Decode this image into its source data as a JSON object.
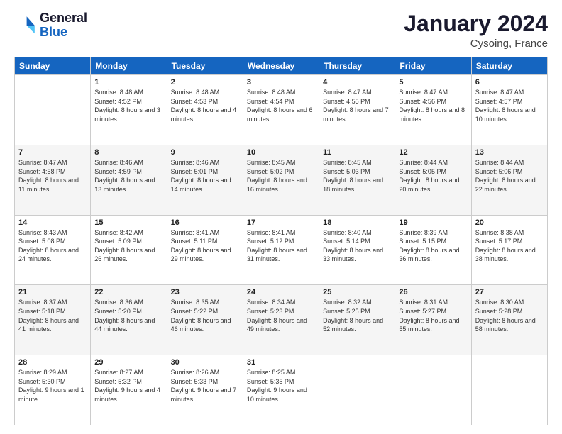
{
  "logo": {
    "line1": "General",
    "line2": "Blue"
  },
  "title": "January 2024",
  "subtitle": "Cysoing, France",
  "days_header": [
    "Sunday",
    "Monday",
    "Tuesday",
    "Wednesday",
    "Thursday",
    "Friday",
    "Saturday"
  ],
  "weeks": [
    [
      {
        "num": "",
        "sunrise": "",
        "sunset": "",
        "daylight": ""
      },
      {
        "num": "1",
        "sunrise": "Sunrise: 8:48 AM",
        "sunset": "Sunset: 4:52 PM",
        "daylight": "Daylight: 8 hours and 3 minutes."
      },
      {
        "num": "2",
        "sunrise": "Sunrise: 8:48 AM",
        "sunset": "Sunset: 4:53 PM",
        "daylight": "Daylight: 8 hours and 4 minutes."
      },
      {
        "num": "3",
        "sunrise": "Sunrise: 8:48 AM",
        "sunset": "Sunset: 4:54 PM",
        "daylight": "Daylight: 8 hours and 6 minutes."
      },
      {
        "num": "4",
        "sunrise": "Sunrise: 8:47 AM",
        "sunset": "Sunset: 4:55 PM",
        "daylight": "Daylight: 8 hours and 7 minutes."
      },
      {
        "num": "5",
        "sunrise": "Sunrise: 8:47 AM",
        "sunset": "Sunset: 4:56 PM",
        "daylight": "Daylight: 8 hours and 8 minutes."
      },
      {
        "num": "6",
        "sunrise": "Sunrise: 8:47 AM",
        "sunset": "Sunset: 4:57 PM",
        "daylight": "Daylight: 8 hours and 10 minutes."
      }
    ],
    [
      {
        "num": "7",
        "sunrise": "Sunrise: 8:47 AM",
        "sunset": "Sunset: 4:58 PM",
        "daylight": "Daylight: 8 hours and 11 minutes."
      },
      {
        "num": "8",
        "sunrise": "Sunrise: 8:46 AM",
        "sunset": "Sunset: 4:59 PM",
        "daylight": "Daylight: 8 hours and 13 minutes."
      },
      {
        "num": "9",
        "sunrise": "Sunrise: 8:46 AM",
        "sunset": "Sunset: 5:01 PM",
        "daylight": "Daylight: 8 hours and 14 minutes."
      },
      {
        "num": "10",
        "sunrise": "Sunrise: 8:45 AM",
        "sunset": "Sunset: 5:02 PM",
        "daylight": "Daylight: 8 hours and 16 minutes."
      },
      {
        "num": "11",
        "sunrise": "Sunrise: 8:45 AM",
        "sunset": "Sunset: 5:03 PM",
        "daylight": "Daylight: 8 hours and 18 minutes."
      },
      {
        "num": "12",
        "sunrise": "Sunrise: 8:44 AM",
        "sunset": "Sunset: 5:05 PM",
        "daylight": "Daylight: 8 hours and 20 minutes."
      },
      {
        "num": "13",
        "sunrise": "Sunrise: 8:44 AM",
        "sunset": "Sunset: 5:06 PM",
        "daylight": "Daylight: 8 hours and 22 minutes."
      }
    ],
    [
      {
        "num": "14",
        "sunrise": "Sunrise: 8:43 AM",
        "sunset": "Sunset: 5:08 PM",
        "daylight": "Daylight: 8 hours and 24 minutes."
      },
      {
        "num": "15",
        "sunrise": "Sunrise: 8:42 AM",
        "sunset": "Sunset: 5:09 PM",
        "daylight": "Daylight: 8 hours and 26 minutes."
      },
      {
        "num": "16",
        "sunrise": "Sunrise: 8:41 AM",
        "sunset": "Sunset: 5:11 PM",
        "daylight": "Daylight: 8 hours and 29 minutes."
      },
      {
        "num": "17",
        "sunrise": "Sunrise: 8:41 AM",
        "sunset": "Sunset: 5:12 PM",
        "daylight": "Daylight: 8 hours and 31 minutes."
      },
      {
        "num": "18",
        "sunrise": "Sunrise: 8:40 AM",
        "sunset": "Sunset: 5:14 PM",
        "daylight": "Daylight: 8 hours and 33 minutes."
      },
      {
        "num": "19",
        "sunrise": "Sunrise: 8:39 AM",
        "sunset": "Sunset: 5:15 PM",
        "daylight": "Daylight: 8 hours and 36 minutes."
      },
      {
        "num": "20",
        "sunrise": "Sunrise: 8:38 AM",
        "sunset": "Sunset: 5:17 PM",
        "daylight": "Daylight: 8 hours and 38 minutes."
      }
    ],
    [
      {
        "num": "21",
        "sunrise": "Sunrise: 8:37 AM",
        "sunset": "Sunset: 5:18 PM",
        "daylight": "Daylight: 8 hours and 41 minutes."
      },
      {
        "num": "22",
        "sunrise": "Sunrise: 8:36 AM",
        "sunset": "Sunset: 5:20 PM",
        "daylight": "Daylight: 8 hours and 44 minutes."
      },
      {
        "num": "23",
        "sunrise": "Sunrise: 8:35 AM",
        "sunset": "Sunset: 5:22 PM",
        "daylight": "Daylight: 8 hours and 46 minutes."
      },
      {
        "num": "24",
        "sunrise": "Sunrise: 8:34 AM",
        "sunset": "Sunset: 5:23 PM",
        "daylight": "Daylight: 8 hours and 49 minutes."
      },
      {
        "num": "25",
        "sunrise": "Sunrise: 8:32 AM",
        "sunset": "Sunset: 5:25 PM",
        "daylight": "Daylight: 8 hours and 52 minutes."
      },
      {
        "num": "26",
        "sunrise": "Sunrise: 8:31 AM",
        "sunset": "Sunset: 5:27 PM",
        "daylight": "Daylight: 8 hours and 55 minutes."
      },
      {
        "num": "27",
        "sunrise": "Sunrise: 8:30 AM",
        "sunset": "Sunset: 5:28 PM",
        "daylight": "Daylight: 8 hours and 58 minutes."
      }
    ],
    [
      {
        "num": "28",
        "sunrise": "Sunrise: 8:29 AM",
        "sunset": "Sunset: 5:30 PM",
        "daylight": "Daylight: 9 hours and 1 minute."
      },
      {
        "num": "29",
        "sunrise": "Sunrise: 8:27 AM",
        "sunset": "Sunset: 5:32 PM",
        "daylight": "Daylight: 9 hours and 4 minutes."
      },
      {
        "num": "30",
        "sunrise": "Sunrise: 8:26 AM",
        "sunset": "Sunset: 5:33 PM",
        "daylight": "Daylight: 9 hours and 7 minutes."
      },
      {
        "num": "31",
        "sunrise": "Sunrise: 8:25 AM",
        "sunset": "Sunset: 5:35 PM",
        "daylight": "Daylight: 9 hours and 10 minutes."
      },
      {
        "num": "",
        "sunrise": "",
        "sunset": "",
        "daylight": ""
      },
      {
        "num": "",
        "sunrise": "",
        "sunset": "",
        "daylight": ""
      },
      {
        "num": "",
        "sunrise": "",
        "sunset": "",
        "daylight": ""
      }
    ]
  ]
}
